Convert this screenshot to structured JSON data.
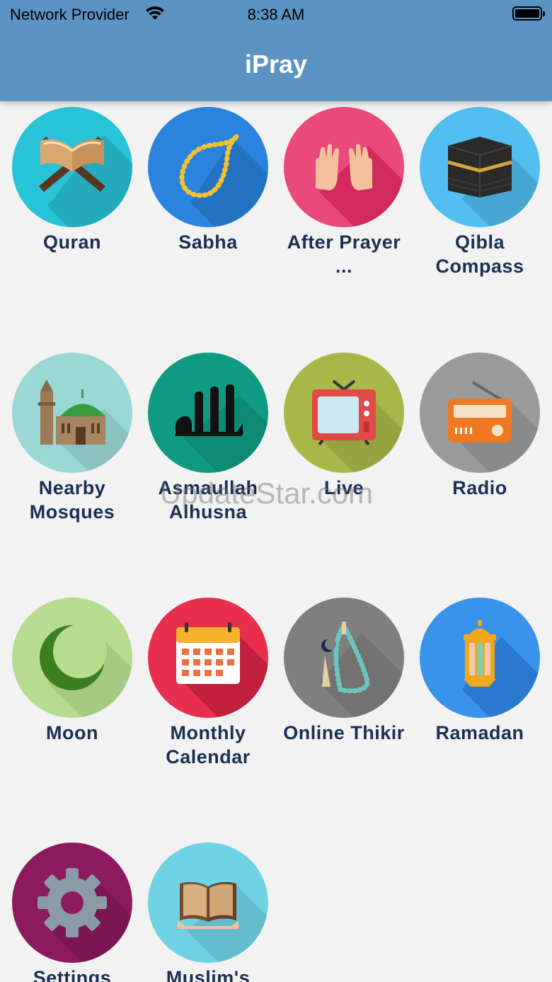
{
  "status_bar": {
    "provider": "Network Provider",
    "time": "8:38 AM",
    "wifi_icon": "wifi-icon",
    "battery_icon": "battery-icon"
  },
  "header": {
    "title": "iPray",
    "color": "#5b94c3"
  },
  "watermark": "UpdateStar.com",
  "tiles": [
    {
      "label": "Quran",
      "icon": "quran-stand-icon",
      "bg": "#28c3d7"
    },
    {
      "label": "Sabha",
      "icon": "prayer-beads-icon",
      "bg": "#2a83dd"
    },
    {
      "label": "After Prayer ...",
      "icon": "praying-hands-icon",
      "bg": "#ea4a7b"
    },
    {
      "label": "Qibla Compass",
      "icon": "kaaba-icon",
      "bg": "#52bff0"
    },
    {
      "label": "Nearby Mosques",
      "icon": "mosque-icon",
      "bg": "#99d8d4"
    },
    {
      "label": "Asmaullah Alhusna",
      "icon": "allah-calligraphy-icon",
      "bg": "#0e9a83"
    },
    {
      "label": "Live",
      "icon": "tv-icon",
      "bg": "#a9b648"
    },
    {
      "label": "Radio",
      "icon": "radio-icon",
      "bg": "#9a9a9a"
    },
    {
      "label": "Moon",
      "icon": "crescent-moon-icon",
      "bg": "#b5dc8f"
    },
    {
      "label": "Monthly Calendar",
      "icon": "calendar-icon",
      "bg": "#e82f4f"
    },
    {
      "label": "Online Thikir",
      "icon": "misbaha-icon",
      "bg": "#7f7f7f"
    },
    {
      "label": "Ramadan",
      "icon": "lantern-icon",
      "bg": "#3a93ea"
    },
    {
      "label": "Settings",
      "icon": "gear-icon",
      "bg": "#8c1a5e"
    },
    {
      "label": "Muslim's",
      "icon": "open-book-icon",
      "bg": "#6fd3e5"
    }
  ]
}
